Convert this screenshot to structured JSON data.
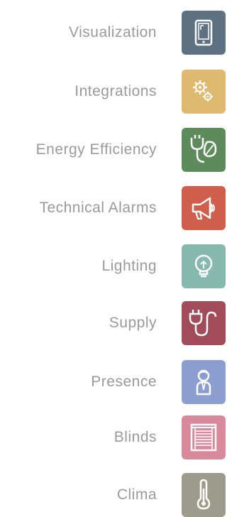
{
  "menu": {
    "items": [
      {
        "label": "Visualization",
        "icon": "tablet-icon",
        "color": "#5d7183"
      },
      {
        "label": "Integrations",
        "icon": "gears-icon",
        "color": "#dfb96f"
      },
      {
        "label": "Energy Efficiency",
        "icon": "plug-leaf-icon",
        "color": "#5d8b5b"
      },
      {
        "label": "Technical Alarms",
        "icon": "megaphone-icon",
        "color": "#cf5f4c"
      },
      {
        "label": "Lighting",
        "icon": "lightbulb-icon",
        "color": "#86b8ad"
      },
      {
        "label": "Supply",
        "icon": "plug-cable-icon",
        "color": "#a14c58"
      },
      {
        "label": "Presence",
        "icon": "person-icon",
        "color": "#8c9ed0"
      },
      {
        "label": "Blinds",
        "icon": "blinds-icon",
        "color": "#d8899b"
      },
      {
        "label": "Clima",
        "icon": "thermometer-icon",
        "color": "#9b9c8c"
      }
    ]
  }
}
